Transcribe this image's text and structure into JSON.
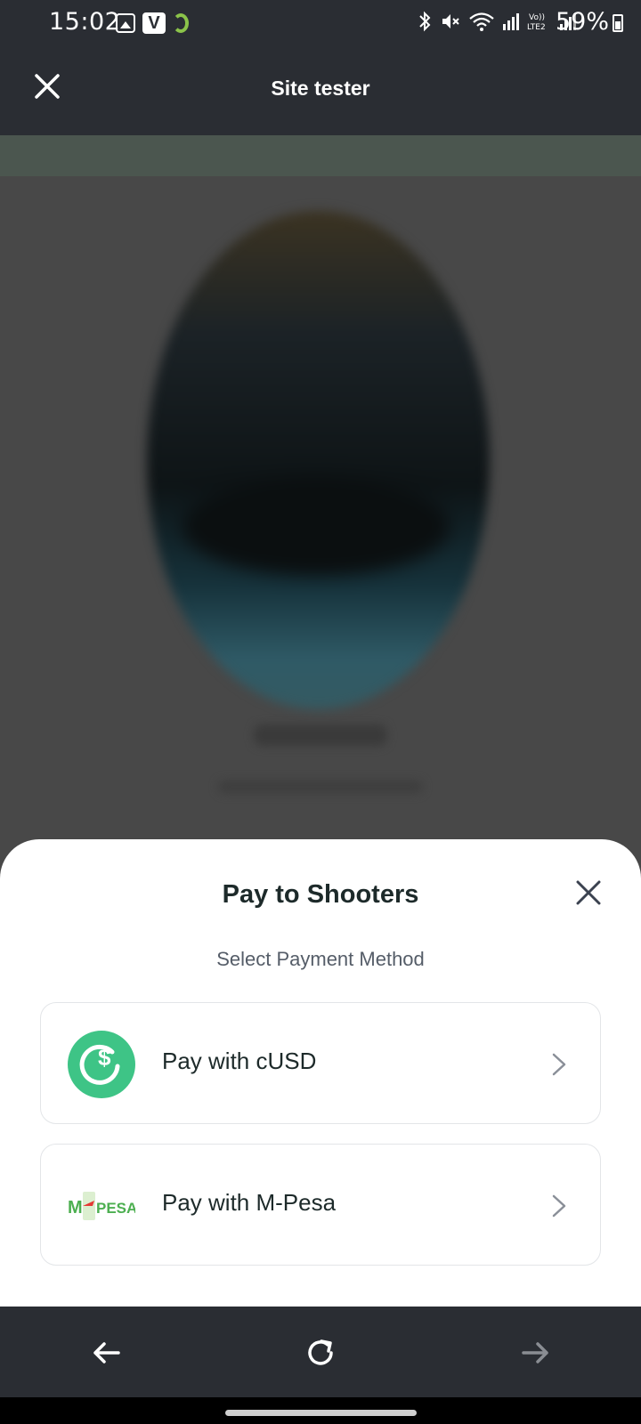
{
  "status_bar": {
    "time": "15:02",
    "battery_percent": "59%",
    "left_icons": [
      "gallery-icon",
      "v-app-icon",
      "leaf-app-icon"
    ],
    "right_icons": [
      "bluetooth-icon",
      "mute-icon",
      "wifi-icon",
      "signal-icon",
      "volte-icon",
      "signal-icon",
      "battery-icon"
    ],
    "volte_label": "Vo)) LTE2"
  },
  "header": {
    "title": "Site tester",
    "close_icon": "close-icon"
  },
  "sheet": {
    "title": "Pay to Shooters",
    "subtitle": "Select Payment Method",
    "options": [
      {
        "label": "Pay with cUSD",
        "icon": "cusd-icon"
      },
      {
        "label": "Pay with M-Pesa",
        "icon": "mpesa-icon",
        "logo_text": "M-PESA"
      }
    ]
  },
  "nav": {
    "back_icon": "arrow-left-icon",
    "reload_icon": "reload-icon",
    "forward_icon": "arrow-right-icon"
  },
  "colors": {
    "bar_bg": "#2a2d33",
    "cusd_green": "#3ec486",
    "mpesa_green": "#4caf50",
    "mpesa_red": "#e53935",
    "title_text": "#1d2a2a",
    "subtitle_text": "#555d68"
  }
}
